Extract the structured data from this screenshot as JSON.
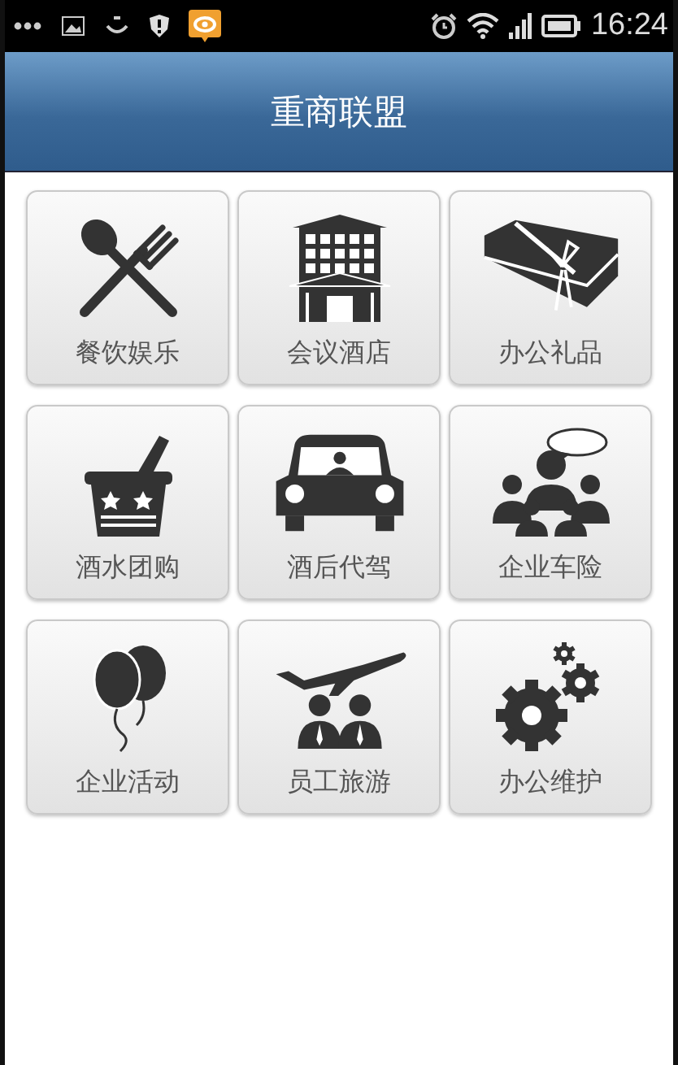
{
  "status_bar": {
    "time": "16:24"
  },
  "header": {
    "title": "重商联盟"
  },
  "tiles": [
    {
      "label": "餐饮娱乐",
      "kind": "dining"
    },
    {
      "label": "会议酒店",
      "kind": "hotel"
    },
    {
      "label": "办公礼品",
      "kind": "gift"
    },
    {
      "label": "酒水团购",
      "kind": "wine"
    },
    {
      "label": "酒后代驾",
      "kind": "car"
    },
    {
      "label": "企业车险",
      "kind": "insurance"
    },
    {
      "label": "企业活动",
      "kind": "balloon"
    },
    {
      "label": "员工旅游",
      "kind": "travel"
    },
    {
      "label": "办公维护",
      "kind": "gears"
    }
  ]
}
